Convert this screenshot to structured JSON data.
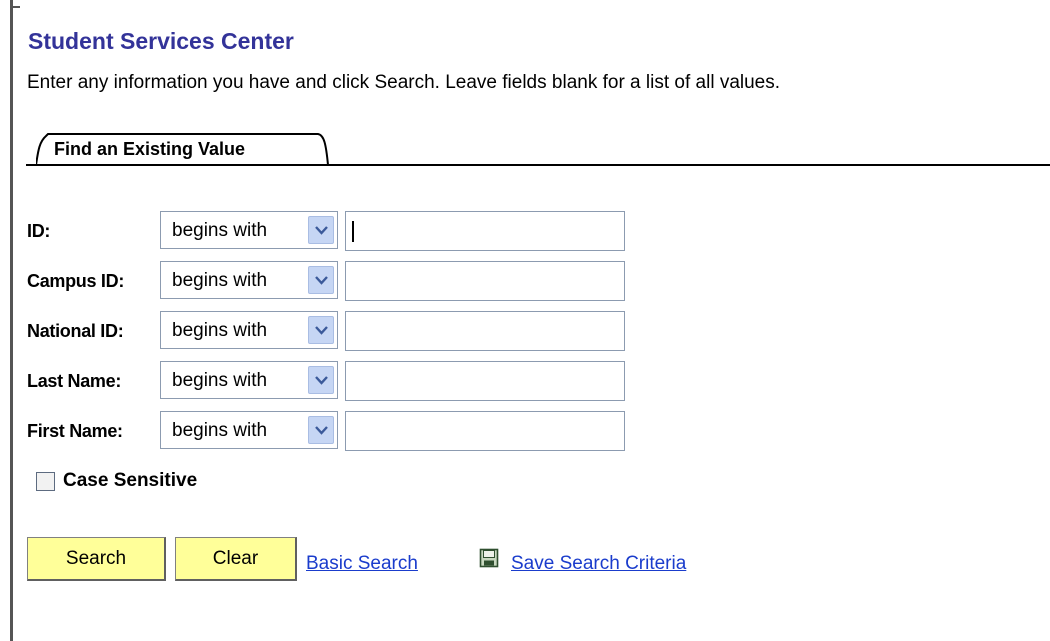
{
  "page": {
    "title": "Student Services Center",
    "instructions": "Enter any information you have and click Search. Leave fields blank for a list of all values."
  },
  "tab": {
    "label": "Find an Existing Value"
  },
  "search_fields": [
    {
      "label": "ID:",
      "operator": "begins with",
      "value": ""
    },
    {
      "label": "Campus ID:",
      "operator": "begins with",
      "value": ""
    },
    {
      "label": "National ID:",
      "operator": "begins with",
      "value": ""
    },
    {
      "label": "Last Name:",
      "operator": "begins with",
      "value": ""
    },
    {
      "label": "First Name:",
      "operator": "begins with",
      "value": ""
    }
  ],
  "case_sensitive": {
    "label": "Case Sensitive",
    "checked": false
  },
  "actions": {
    "search_label": "Search",
    "clear_label": "Clear",
    "basic_search_link": "Basic Search",
    "save_search_link": "Save Search Criteria",
    "save_icon": "save-disk-icon"
  },
  "colors": {
    "title": "#333399",
    "button_bg": "#ffff99",
    "link": "#1a3ccc",
    "dropdown_button": "#c6d6f4"
  }
}
